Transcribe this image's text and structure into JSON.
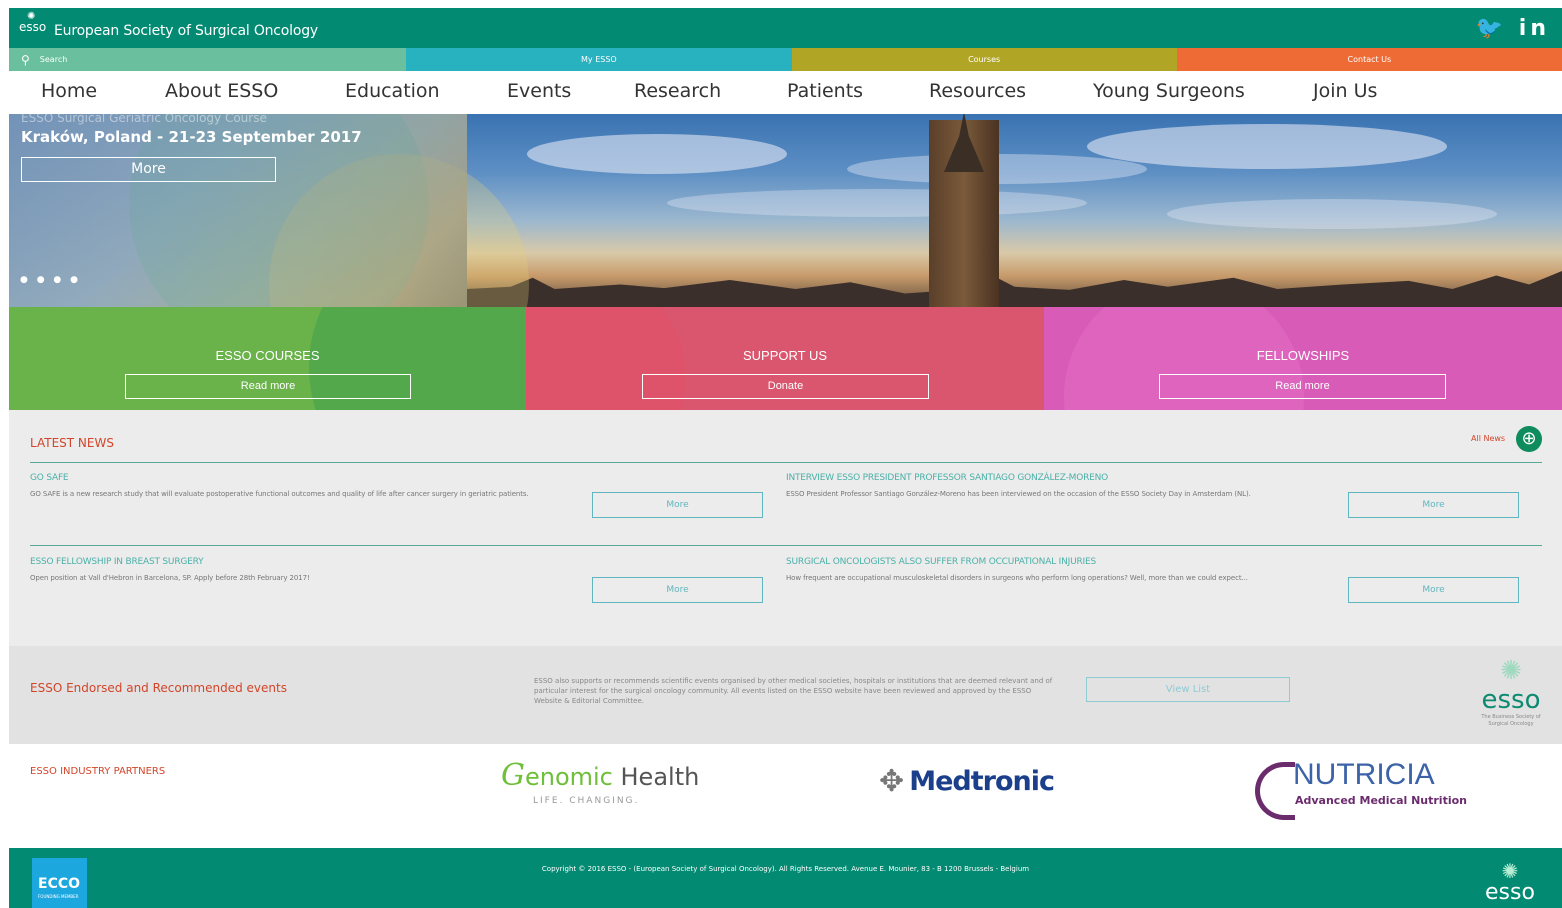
{
  "header": {
    "site_title": "European Society of Surgical Oncology",
    "logo_text": "esso",
    "social": {
      "twitter": "🐦",
      "linkedin": "in"
    }
  },
  "utility": {
    "search": "Search",
    "my_esso": "My ESSO",
    "courses": "Courses",
    "contact": "Contact Us",
    "colors": [
      "#6abf9e",
      "#28b1bf",
      "#b1a526",
      "#ef6b35"
    ]
  },
  "nav": [
    "Home",
    "About ESSO",
    "Education",
    "Events",
    "Research",
    "Patients",
    "Resources",
    "Young Surgeons",
    "Join Us"
  ],
  "hero": {
    "subtitle": "ESSO Surgical Geriatric Oncology Course",
    "title": "Kraków, Poland - 21-23 September 2017",
    "button": "More",
    "dots": "● ● ● ●"
  },
  "promos": [
    {
      "title": "ESSO COURSES",
      "button": "Read more",
      "color": "#6ab24a"
    },
    {
      "title": "SUPPORT US",
      "button": "Donate",
      "color": "#d9566e"
    },
    {
      "title": "FELLOWSHIPS",
      "button": "Read more",
      "color": "#d85cb7"
    }
  ],
  "news": {
    "heading": "LATEST NEWS",
    "all_news": "All News",
    "more_label": "More",
    "items": [
      {
        "title": "GO SAFE",
        "text": "GO SAFE is a new research study that will evaluate postoperative functional outcomes and quality of life after cancer surgery in geriatric patients."
      },
      {
        "title": "INTERVIEW ESSO PRESIDENT PROFESSOR SANTIAGO GONZÁLEZ-MORENO",
        "text": "ESSO President Professor Santiago González-Moreno has been interviewed on the occasion of the ESSO Society Day in Amsterdam (NL)."
      },
      {
        "title": "ESSO FELLOWSHIP IN BREAST SURGERY",
        "text": "Open position at Vall d'Hebron in Barcelona, SP. Apply before 28th February 2017!"
      },
      {
        "title": "SURGICAL ONCOLOGISTS ALSO SUFFER FROM OCCUPATIONAL INJURIES",
        "text": "How frequent are occupational musculoskeletal disorders in surgeons who perform long operations? Well, more than we could expect..."
      }
    ]
  },
  "events": {
    "heading": "ESSO Endorsed and Recommended events",
    "text": "ESSO also supports or recommends scientific events organised by other medical societies, hospitals or institutions that are deemed relevant and of particular interest for the surgical oncology community. All events listed on the ESSO website have been reviewed and approved by the ESSO Website & Editorial Committee.",
    "button": "View List",
    "logo_word": "esso",
    "logo_tag": "The Business Society of Surgical Oncology"
  },
  "partners": {
    "heading": "ESSO INDUSTRY PARTNERS",
    "genomic": {
      "mark": "G",
      "name1": "enomic",
      "name2": " Health",
      "tag": "LIFE. CHANGING."
    },
    "medtronic": {
      "symbol": "✥",
      "name": "Medtronic"
    },
    "nutricia": {
      "name": "NUTRICIA",
      "sub": "Advanced Medical Nutrition"
    }
  },
  "footer": {
    "ecco_word": "ECCO",
    "ecco_sub": "FOUNDING MEMBER",
    "copyright": "Copyright © 2016 ESSO - (European Society of Surgical Oncology). All Rights Reserved. Avenue E. Mounier, 83 - B 1200 Brussels - Belgium",
    "logo_word": "esso"
  }
}
